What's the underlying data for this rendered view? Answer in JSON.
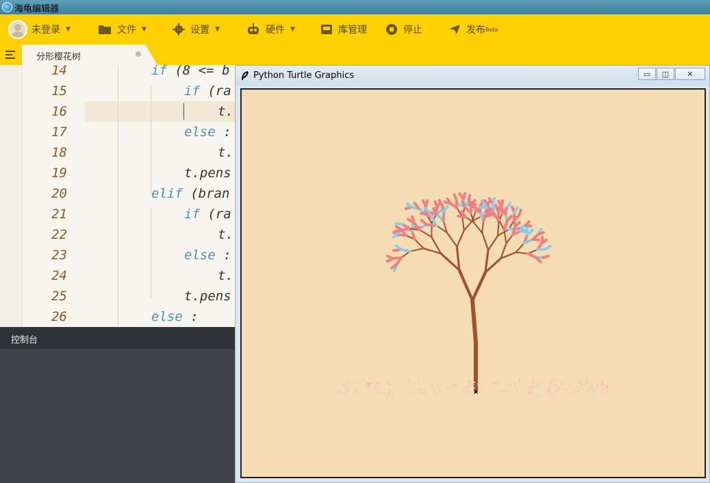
{
  "window": {
    "title": "海龟编辑器"
  },
  "toolbar": {
    "login_label": "未登录",
    "file_label": "文件",
    "settings_label": "设置",
    "hardware_label": "硬件",
    "library_label": "库管理",
    "stop_label": "停止",
    "publish_label": "发布",
    "publish_badge": "Beta"
  },
  "tab": {
    "label": "分形樱花树"
  },
  "editor": {
    "line_numbers": [
      "14",
      "15",
      "16",
      "17",
      "18",
      "19",
      "20",
      "21",
      "22",
      "23",
      "24",
      "25",
      "26"
    ],
    "lines": [
      {
        "kw": "if",
        "rest": " (8 <= b"
      },
      {
        "kw": "if",
        "rest": " (ra"
      },
      {
        "kw": "",
        "rest": "t."
      },
      {
        "kw": "else",
        "rest": " :"
      },
      {
        "kw": "",
        "rest": "t."
      },
      {
        "kw": "",
        "rest": "t.pens"
      },
      {
        "kw": "elif",
        "rest": " (bran"
      },
      {
        "kw": "if",
        "rest": " (ra"
      },
      {
        "kw": "",
        "rest": "t."
      },
      {
        "kw": "else",
        "rest": " :"
      },
      {
        "kw": "",
        "rest": "t."
      },
      {
        "kw": "",
        "rest": "t.pens"
      },
      {
        "kw": "else",
        "rest": " :"
      }
    ]
  },
  "console": {
    "title": "控制台"
  },
  "turtle_window": {
    "title": "Python Turtle Graphics",
    "canvas_color": "#f5dcb3",
    "trunk_color": "#a0522d",
    "blossom_colors": [
      "#f08080",
      "#87ceeb"
    ],
    "petal_color": "#ffb6c1"
  },
  "colors": {
    "toolbar": "#ffd000",
    "keyword": "#4a90c8",
    "line_number": "#8a5a2b"
  }
}
